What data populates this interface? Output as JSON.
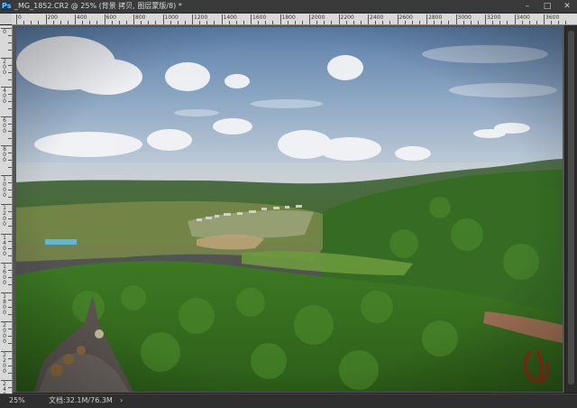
{
  "window": {
    "title": "_MG_1852.CR2 @ 25% (背景 拷贝, 图层蒙版/8) *",
    "app_icon": "Ps",
    "controls": {
      "minimize": "–",
      "maximize": "□",
      "close": "✕"
    }
  },
  "ruler": {
    "h_labels": [
      "0",
      "200",
      "400",
      "600",
      "800",
      "1000",
      "1200",
      "1400",
      "1600",
      "1800",
      "2000",
      "2200",
      "2400",
      "2600",
      "2800",
      "3000",
      "3200",
      "3400",
      "3600"
    ],
    "v_labels": [
      "0",
      "200",
      "400",
      "600",
      "800",
      "1000",
      "1200",
      "1400",
      "1600",
      "1800",
      "2000",
      "2200",
      "2400"
    ]
  },
  "status": {
    "zoom": "25%",
    "doc_info": "文档:32.1M/76.3M",
    "arrow": "›"
  },
  "colors": {
    "sky_top": "#5d7fa8",
    "sky_mid": "#8aa4c2",
    "sky_horizon": "#c9d3dc",
    "forest_near": "#3e7a22",
    "forest_far": "#2f5e2a",
    "watermark": "#c31414"
  }
}
